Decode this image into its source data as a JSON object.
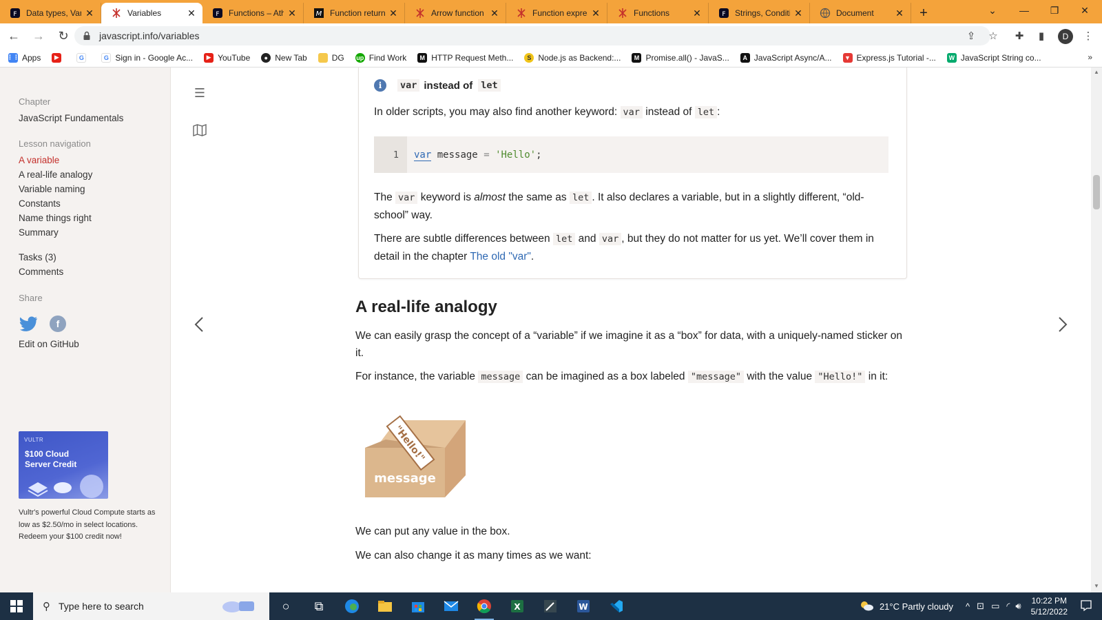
{
  "browser": {
    "tabs": [
      {
        "title": "Data types, Var",
        "favicon": "freecodecamp-icon",
        "active": false
      },
      {
        "title": "Variables",
        "favicon": "javascript-info-icon",
        "active": true
      },
      {
        "title": "Functions – Ath",
        "favicon": "freecodecamp-icon",
        "active": false
      },
      {
        "title": "Function return",
        "favicon": "mdn-icon",
        "active": false
      },
      {
        "title": "Arrow function",
        "favicon": "javascript-info-icon",
        "active": false
      },
      {
        "title": "Function expres",
        "favicon": "javascript-info-icon",
        "active": false
      },
      {
        "title": "Functions",
        "favicon": "javascript-info-icon",
        "active": false
      },
      {
        "title": "Strings, Conditi",
        "favicon": "freecodecamp-icon",
        "active": false
      },
      {
        "title": "Document",
        "favicon": "globe-icon",
        "active": false
      }
    ],
    "url": "javascript.info/variables",
    "profile_initial": "D",
    "bookmarks": [
      {
        "label": "Apps",
        "icon": "apps-grid-icon",
        "color": "#4285f4"
      },
      {
        "label": "",
        "icon": "youtube-icon",
        "color": "#e62117"
      },
      {
        "label": "",
        "icon": "google-icon",
        "color": "#4285f4"
      },
      {
        "label": "Sign in - Google Ac...",
        "icon": "google-icon",
        "color": "#4285f4"
      },
      {
        "label": "YouTube",
        "icon": "youtube-icon",
        "color": "#e62117"
      },
      {
        "label": "New Tab",
        "icon": "github-icon",
        "color": "#222222"
      },
      {
        "label": "DG",
        "icon": "folder-icon",
        "color": "#f5c84c"
      },
      {
        "label": "Find Work",
        "icon": "upwork-icon",
        "color": "#14a800"
      },
      {
        "label": "HTTP Request Meth...",
        "icon": "mdn-icon",
        "color": "#111111"
      },
      {
        "label": "Node.js as Backend:...",
        "icon": "stackoverflow-icon",
        "color": "#f0c419"
      },
      {
        "label": "Promise.all() - JavaS...",
        "icon": "mdn-icon",
        "color": "#111111"
      },
      {
        "label": "JavaScript Async/A...",
        "icon": "mdn-icon",
        "color": "#111111"
      },
      {
        "label": "Express.js Tutorial -...",
        "icon": "tutorial-icon",
        "color": "#e53935"
      },
      {
        "label": "JavaScript String co...",
        "icon": "w3schools-icon",
        "color": "#04aa6d"
      }
    ]
  },
  "sidebar": {
    "chapter_label": "Chapter",
    "chapter_title": "JavaScript Fundamentals",
    "lesson_label": "Lesson navigation",
    "lessons": [
      "A variable",
      "A real-life analogy",
      "Variable naming",
      "Constants",
      "Name things right",
      "Summary"
    ],
    "tasks": "Tasks (3)",
    "comments": "Comments",
    "share_label": "Share",
    "edit_github": "Edit on GitHub",
    "ad": {
      "brand": "VULTR",
      "headline_1": "$100 Cloud",
      "headline_2": "Server Credit",
      "text": "Vultr's powerful Cloud Compute starts as low as $2.50/mo in select locations. Redeem your $100 credit now!"
    }
  },
  "article": {
    "note": {
      "title_code_1": "var",
      "title_mid": "instead of",
      "title_code_2": "let",
      "p1_a": "In older scripts, you may also find another keyword:",
      "p1_code_1": "var",
      "p1_mid": "instead of",
      "p1_code_2": "let",
      "p1_end": ":",
      "code_line_number": "1",
      "code_kw": "var",
      "code_ident": "message",
      "code_op": "=",
      "code_str": "'Hello'",
      "code_end": ";",
      "p2_a": "The",
      "p2_code_1": "var",
      "p2_b": "keyword is",
      "p2_em": "almost",
      "p2_c": "the same as",
      "p2_code_2": "let",
      "p2_d": ". It also declares a variable, but in a slightly different, “old-school” way.",
      "p3_a": "There are subtle differences between",
      "p3_code_1": "let",
      "p3_b": "and",
      "p3_code_2": "var",
      "p3_c": ", but they do not matter for us yet. We’ll cover them in detail in the chapter",
      "p3_link": "The old \"var\"",
      "p3_end": "."
    },
    "section_title": "A real-life analogy",
    "s_p1": "We can easily grasp the concept of a “variable” if we imagine it as a “box” for data, with a uniquely-named sticker on it.",
    "s_p2_a": "For instance, the variable",
    "s_p2_code_1": "message",
    "s_p2_b": "can be imagined as a box labeled",
    "s_p2_code_2": "\"message\"",
    "s_p2_c": "with the value",
    "s_p2_code_3": "\"Hello!\"",
    "s_p2_d": "in it:",
    "box_label": "message",
    "box_sticker": "\"Hello!\"",
    "s_p3": "We can put any value in the box.",
    "s_p4": "We can also change it as many times as we want:"
  },
  "taskbar": {
    "search_placeholder": "Type here to search",
    "weather": "21°C  Partly cloudy",
    "time": "10:22 PM",
    "date": "5/12/2022"
  }
}
